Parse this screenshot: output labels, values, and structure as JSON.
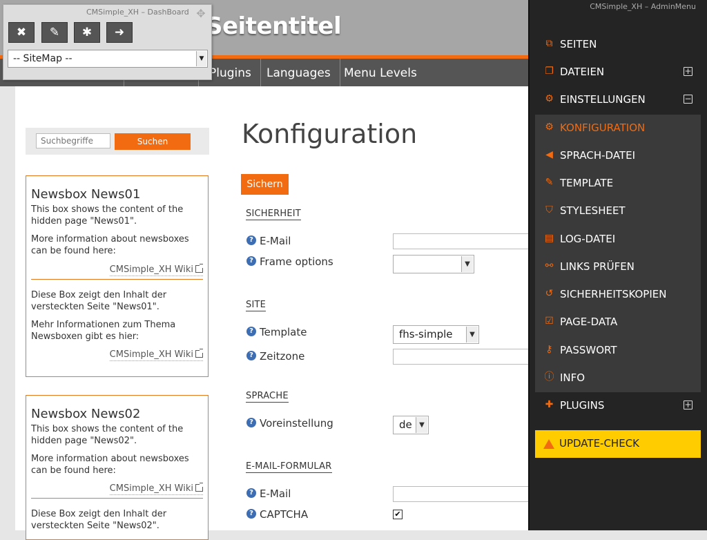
{
  "header": {
    "site_title": "Seitentitel"
  },
  "nav": {
    "items": [
      "",
      "",
      "",
      "Plugins",
      "Languages",
      "Menu Levels"
    ]
  },
  "search": {
    "placeholder": "Suchbegriffe",
    "button": "Suchen"
  },
  "newsboxes": [
    {
      "title": "Newsbox News01",
      "en_text": "This box shows the content of the hidden page \"News01\".",
      "en_more": "More information about newsboxes can be found here:",
      "link": "CMSimple_XH Wiki",
      "de_text": "Diese Box zeigt den Inhalt der versteckten Seite \"News01\".",
      "de_more": "Mehr Informationen zum Thema Newsboxen gibt es hier:",
      "link2": "CMSimple_XH Wiki"
    },
    {
      "title": "Newsbox News02",
      "en_text": "This box shows the content of the hidden page \"News02\".",
      "en_more": "More information about newsboxes can be found here:",
      "link": "CMSimple_XH Wiki",
      "de_text": "Diese Box zeigt den Inhalt der versteckten Seite \"News02\"."
    }
  ],
  "main": {
    "title": "Konfiguration",
    "save": "Sichern",
    "sections": {
      "security": "SICHERHEIT",
      "site": "SITE",
      "language": "SPRACHE",
      "mailform": "E-MAIL-FORMULAR"
    },
    "fields": {
      "security_email": "E-Mail",
      "frame_options": "Frame options",
      "template": "Template",
      "template_value": "fhs-simple",
      "timezone": "Zeitzone",
      "default_language": "Voreinstellung",
      "default_language_value": "de",
      "mailform_email": "E-Mail",
      "captcha": "CAPTCHA",
      "captcha_checked": true
    }
  },
  "admin_menu": {
    "title": "CMSimple_XH – AdminMenu",
    "items": {
      "pages": "SEITEN",
      "files": "DATEIEN",
      "settings": "EINSTELLUNGEN",
      "config": "KONFIGURATION",
      "language_file": "SPRACH-DATEI",
      "template": "TEMPLATE",
      "stylesheet": "STYLESHEET",
      "log": "LOG-DATEI",
      "links": "LINKS PRÜFEN",
      "backups": "SICHERHEITSKOPIEN",
      "pagedata": "PAGE-DATA",
      "password": "PASSWORT",
      "info": "INFO",
      "plugins": "PLUGINS",
      "update": "UPDATE-CHECK"
    },
    "active": "KONFIGURATION"
  },
  "dashboard": {
    "title": "CMSimple_XH – DashBoard",
    "sitemap": "-- SiteMap --"
  },
  "colors": {
    "accent": "#f26b10",
    "admin_bg": "#242424",
    "update_bg": "#ffcc00"
  }
}
